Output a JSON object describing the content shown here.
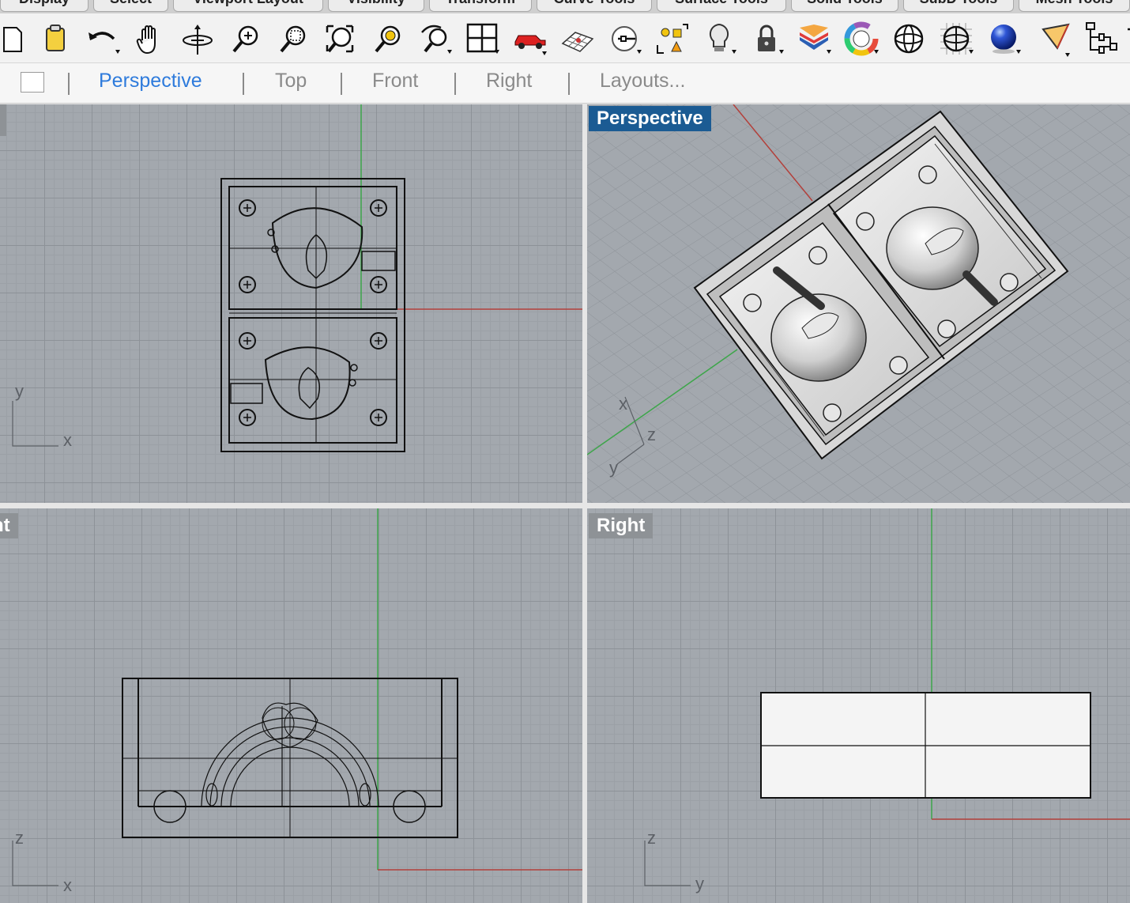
{
  "ribbon_tabs": [
    "Display",
    "Select",
    "Viewport Layout",
    "Visibility",
    "Transform",
    "Curve Tools",
    "Surface Tools",
    "Solid Tools",
    "SubD Tools",
    "Mesh Tools"
  ],
  "toolbar_icons": [
    "new-icon",
    "paste-icon",
    "undo-icon",
    "pan-hand-icon",
    "rotate-view-icon",
    "zoom-icon",
    "zoom-window-icon",
    "zoom-extents-icon",
    "zoom-selected-icon",
    "undo-view-icon",
    "four-viewports-icon",
    "car-icon",
    "grid-icon",
    "point-icon",
    "shapes-icon",
    "light-icon",
    "lock-icon",
    "layers-icon",
    "color-wheel-icon",
    "sphere-wire-icon",
    "sphere-grid-icon",
    "blue-sphere-icon",
    "cone-icon",
    "hierarchy-icon"
  ],
  "view_tabs": {
    "items": [
      "Perspective",
      "Top",
      "Front",
      "Right",
      "Layouts..."
    ],
    "active": "Perspective"
  },
  "viewports": {
    "top": {
      "label": "",
      "axis_v": "y",
      "axis_h": "x"
    },
    "perspective": {
      "label": "Perspective",
      "axis_1": "x",
      "axis_2": "z",
      "axis_3": "y"
    },
    "front": {
      "label": "nt",
      "axis_v": "z",
      "axis_h": "x"
    },
    "right": {
      "label": "Right",
      "axis_v": "z",
      "axis_h": "y"
    }
  },
  "colors": {
    "accent": "#2e7bdc",
    "x_axis": "#b3403b",
    "y_axis": "#3da64a",
    "perspective_label": "#1b5b93"
  }
}
